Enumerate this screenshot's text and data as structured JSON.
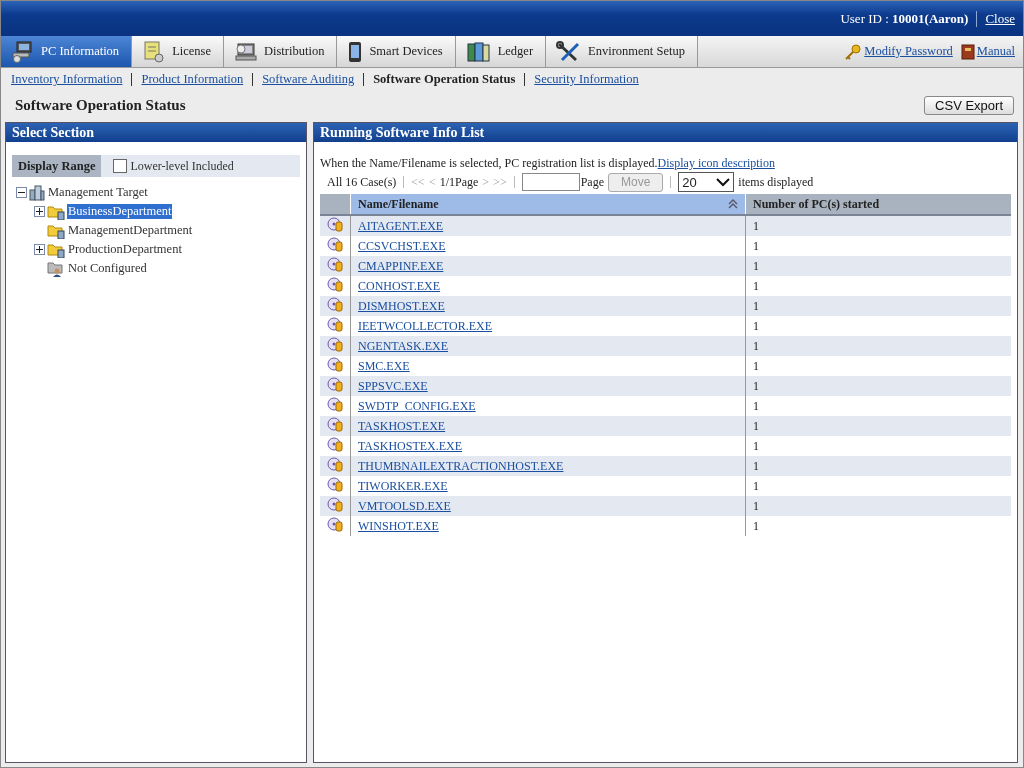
{
  "header": {
    "user": "User ID : **10001(Aaron)**",
    "close": "Close"
  },
  "tabs": [
    {
      "label": "PC Information",
      "selected": true
    },
    {
      "label": "License",
      "selected": false
    },
    {
      "label": "Distribution",
      "selected": false
    },
    {
      "label": "Smart Devices",
      "selected": false
    },
    {
      "label": "Ledger",
      "selected": false
    },
    {
      "label": "Environment Setup",
      "selected": false
    }
  ],
  "top_links": [
    {
      "label": "Modify Password"
    },
    {
      "label": "Manual"
    }
  ],
  "subnav": [
    {
      "label": "Inventory Information",
      "selected": false
    },
    {
      "label": "Product Information",
      "selected": false
    },
    {
      "label": "Software Auditing",
      "selected": false
    },
    {
      "label": "Software Operation Status",
      "selected": true
    },
    {
      "label": "Security Information",
      "selected": false
    }
  ],
  "page_title": "Software Operation Status",
  "csv_button": "CSV Export",
  "left_panel": {
    "title": "Select Section",
    "display_range": "Display Range",
    "lower_level": {
      "label": "Lower-level Included",
      "checked": false
    },
    "tree": {
      "label": "Management Target",
      "kind": "root",
      "expanded": true,
      "selected": false,
      "children": [
        {
          "label": "BusinessDepartment",
          "kind": "department",
          "expanded": false,
          "selected": true
        },
        {
          "label": "ManagementDepartment",
          "kind": "department",
          "selected": false
        },
        {
          "label": "ProductionDepartment",
          "kind": "department",
          "expanded": false,
          "selected": false
        },
        {
          "label": "Not Configured",
          "kind": "unconfigured",
          "selected": false
        }
      ]
    }
  },
  "right_panel": {
    "title": "Running Software Info List",
    "hint": "When the Name/Filename is selected, PC registration list is displayed.",
    "hint_link": "Display icon description",
    "pager": {
      "count": "All 16 Case(s)",
      "first": "<<",
      "prev": "<",
      "page": "1/1Page",
      "next": ">",
      "last": ">>",
      "page_label": "Page",
      "move": {
        "label": "Move",
        "disabled": true
      },
      "per_page": "20",
      "per_page_label": "items displayed"
    },
    "columns": [
      {
        "label": "Name/Filename",
        "sorted": true
      },
      {
        "label": "Number of PC(s) started",
        "sorted": false
      }
    ],
    "rows": [
      {
        "name": "AITAGENT.EXE",
        "count": "1"
      },
      {
        "name": "CCSVCHST.EXE",
        "count": "1"
      },
      {
        "name": "CMAPPINF.EXE",
        "count": "1"
      },
      {
        "name": "CONHOST.EXE",
        "count": "1"
      },
      {
        "name": "DISMHOST.EXE",
        "count": "1"
      },
      {
        "name": "IEETWCOLLECTOR.EXE",
        "count": "1"
      },
      {
        "name": "NGENTASK.EXE",
        "count": "1"
      },
      {
        "name": "SMC.EXE",
        "count": "1"
      },
      {
        "name": "SPPSVC.EXE",
        "count": "1"
      },
      {
        "name": "SWDTP_CONFIG.EXE",
        "count": "1"
      },
      {
        "name": "TASKHOST.EXE",
        "count": "1"
      },
      {
        "name": "TASKHOSTEX.EXE",
        "count": "1"
      },
      {
        "name": "THUMBNAILEXTRACTIONHOST.EXE",
        "count": "1"
      },
      {
        "name": "TIWORKER.EXE",
        "count": "1"
      },
      {
        "name": "VMTOOLSD.EXE",
        "count": "1"
      },
      {
        "name": "WINSHOT.EXE",
        "count": "1"
      }
    ]
  }
}
